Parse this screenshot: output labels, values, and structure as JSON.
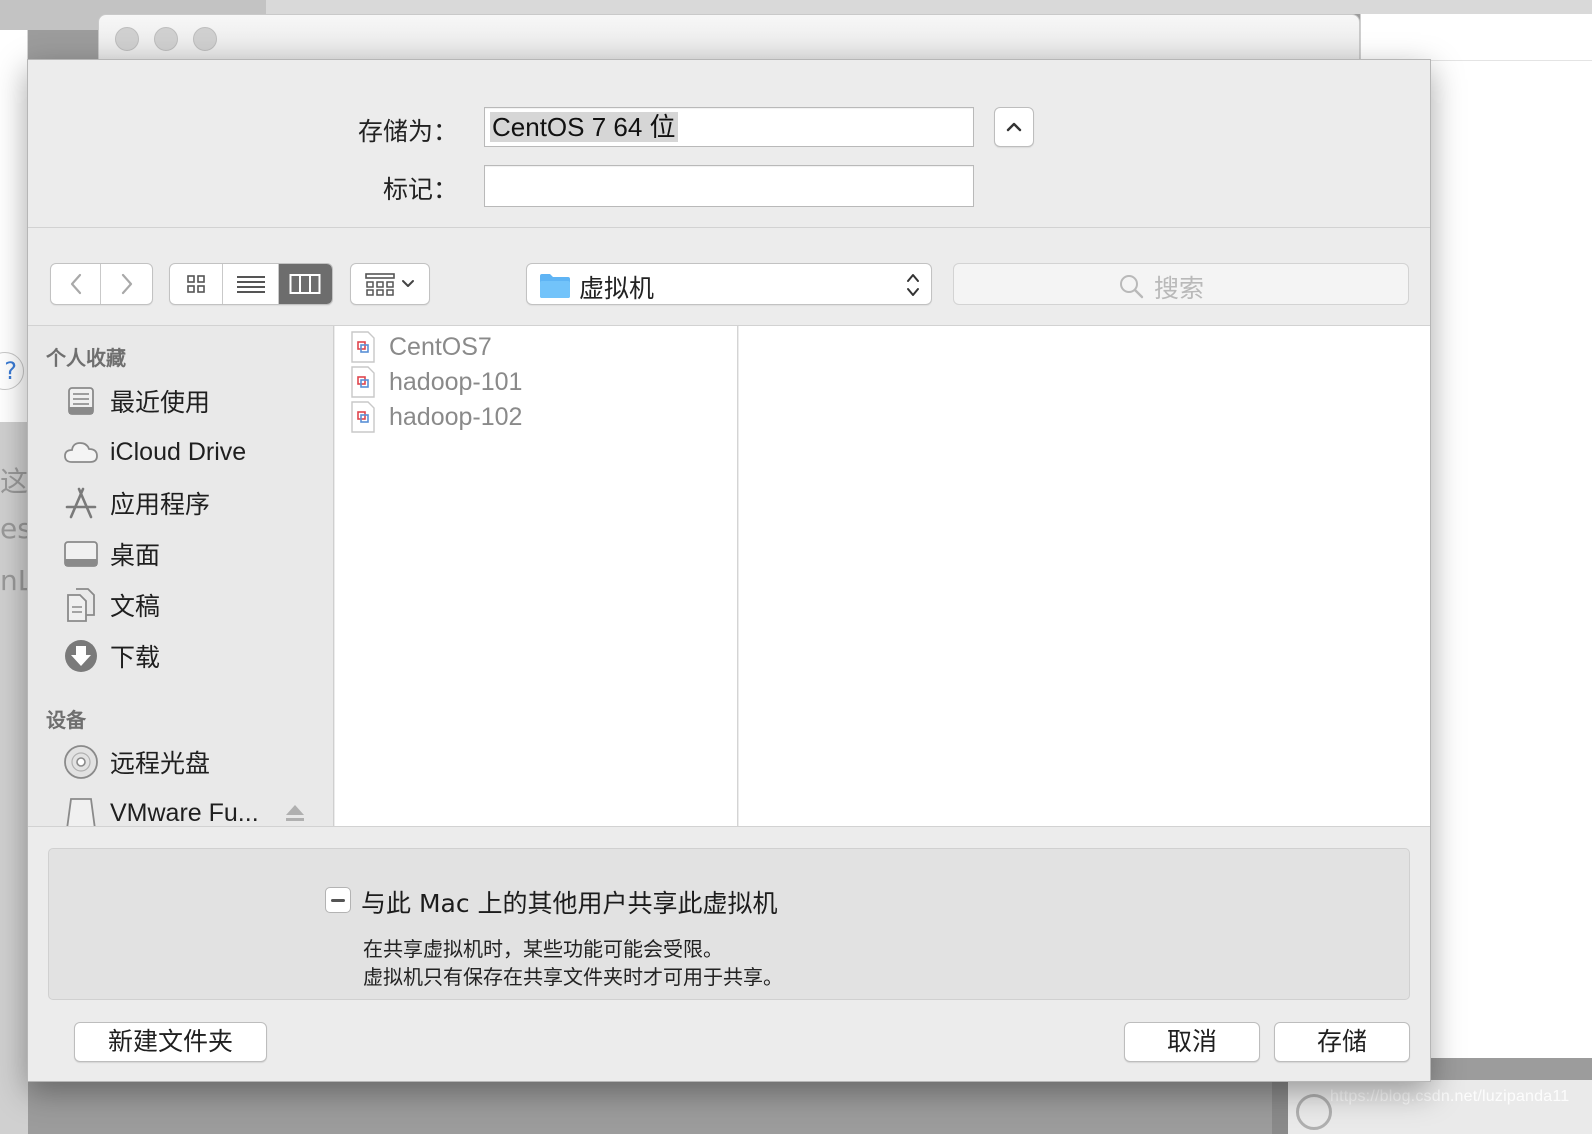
{
  "save_as": {
    "label": "存储为：",
    "value": "CentOS 7 64 位"
  },
  "tags": {
    "label": "标记：",
    "value": ""
  },
  "toolbar": {
    "location": "虚拟机",
    "search_placeholder": "搜索"
  },
  "sidebar": {
    "favorites_header": "个人收藏",
    "favorites": [
      {
        "label": "最近使用",
        "icon": "recents-icon"
      },
      {
        "label": "iCloud Drive",
        "icon": "cloud-icon"
      },
      {
        "label": "应用程序",
        "icon": "applications-icon"
      },
      {
        "label": "桌面",
        "icon": "desktop-icon"
      },
      {
        "label": "文稿",
        "icon": "documents-icon"
      },
      {
        "label": "下载",
        "icon": "download-icon"
      }
    ],
    "devices_header": "设备",
    "devices": [
      {
        "label": "远程光盘",
        "icon": "disc-icon"
      },
      {
        "label": "VMware Fu...",
        "icon": "drive-icon"
      }
    ]
  },
  "files": [
    {
      "name": "CentOS7"
    },
    {
      "name": "hadoop-101"
    },
    {
      "name": "hadoop-102"
    }
  ],
  "options": {
    "share_checkbox_label": "与此 Mac 上的其他用户共享此虚拟机",
    "share_help_line1": "在共享虚拟机时，某些功能可能会受限。",
    "share_help_line2": "虚拟机只有保存在共享文件夹时才可用于共享。"
  },
  "buttons": {
    "new_folder": "新建文件夹",
    "cancel": "取消",
    "save": "存储"
  },
  "watermark": "https://blog.csdn.net/luzipanda11",
  "background_fragments": [
    "这里",
    "es",
    "nL"
  ],
  "colors": {
    "folder_blue": "#5fb4f4",
    "active_segment": "#6d6d6d",
    "file_icon_red": "#e0464e"
  }
}
